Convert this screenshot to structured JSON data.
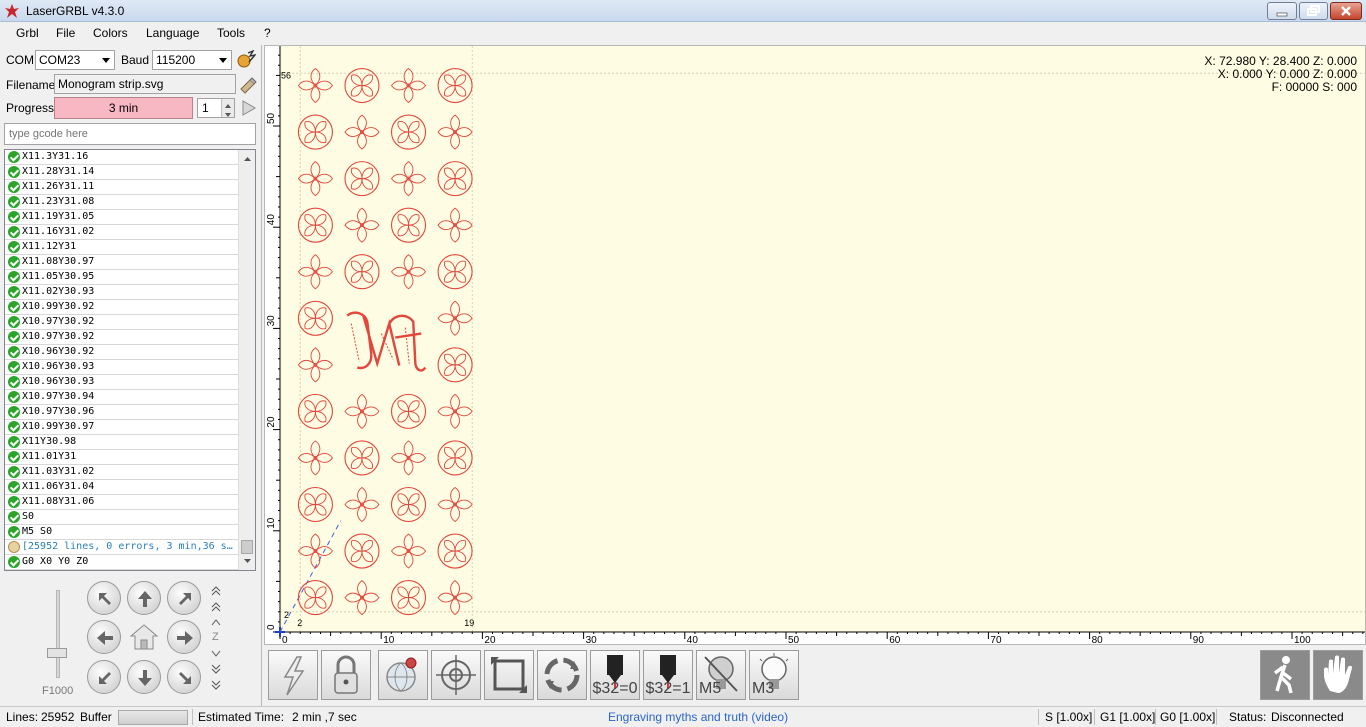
{
  "window": {
    "title": "LaserGRBL v4.3.0"
  },
  "menu": [
    "Grbl",
    "File",
    "Colors",
    "Language",
    "Tools",
    "?"
  ],
  "connection": {
    "com_label": "COM",
    "com_value": "COM23",
    "baud_label": "Baud",
    "baud_value": "115200"
  },
  "file": {
    "filename_label": "Filename",
    "filename_value": "Monogram strip.svg"
  },
  "progress": {
    "label": "Progress",
    "text": "3 min",
    "passes": "1"
  },
  "gcode_input": {
    "placeholder": "type gcode here"
  },
  "log_lines": [
    {
      "text": "X11.3Y31.16",
      "kind": "ok"
    },
    {
      "text": "X11.28Y31.14",
      "kind": "ok"
    },
    {
      "text": "X11.26Y31.11",
      "kind": "ok"
    },
    {
      "text": "X11.23Y31.08",
      "kind": "ok"
    },
    {
      "text": "X11.19Y31.05",
      "kind": "ok"
    },
    {
      "text": "X11.16Y31.02",
      "kind": "ok"
    },
    {
      "text": "X11.12Y31",
      "kind": "ok"
    },
    {
      "text": "X11.08Y30.97",
      "kind": "ok"
    },
    {
      "text": "X11.05Y30.95",
      "kind": "ok"
    },
    {
      "text": "X11.02Y30.93",
      "kind": "ok"
    },
    {
      "text": "X10.99Y30.92",
      "kind": "ok"
    },
    {
      "text": "X10.97Y30.92",
      "kind": "ok"
    },
    {
      "text": "X10.97Y30.92",
      "kind": "ok"
    },
    {
      "text": "X10.96Y30.92",
      "kind": "ok"
    },
    {
      "text": "X10.96Y30.93",
      "kind": "ok"
    },
    {
      "text": "X10.96Y30.93",
      "kind": "ok"
    },
    {
      "text": "X10.97Y30.94",
      "kind": "ok"
    },
    {
      "text": "X10.97Y30.96",
      "kind": "ok"
    },
    {
      "text": "X10.99Y30.97",
      "kind": "ok"
    },
    {
      "text": "X11Y30.98",
      "kind": "ok"
    },
    {
      "text": "X11.01Y31",
      "kind": "ok"
    },
    {
      "text": "X11.03Y31.02",
      "kind": "ok"
    },
    {
      "text": "X11.06Y31.04",
      "kind": "ok"
    },
    {
      "text": "X11.08Y31.06",
      "kind": "ok"
    },
    {
      "text": "S0",
      "kind": "ok"
    },
    {
      "text": "M5 S0",
      "kind": "ok"
    },
    {
      "text": "[25952 lines, 0 errors, 3 min,36 s…",
      "kind": "info"
    },
    {
      "text": "G0 X0 Y0 Z0",
      "kind": "ok"
    }
  ],
  "jog": {
    "feed": "F1000",
    "z_label": "Z"
  },
  "canvas": {
    "coords_line1": "X: 72.980 Y: 28.400 Z: 0.000",
    "coords_line2": "X: 0.000 Y: 0.000 Z: 0.000",
    "coords_line3": "F: 00000 S: 000",
    "x_ticks": [
      0,
      10,
      20,
      30,
      40,
      50,
      60,
      70,
      80,
      90,
      100
    ],
    "y_ticks": [
      0,
      10,
      20,
      30,
      40,
      50
    ],
    "bounds_labels": {
      "x_min": "2",
      "x_max": "19",
      "y_min": "2",
      "y_max": "56"
    },
    "drawing_color": "#e2463c",
    "background": "#fefde3"
  },
  "toolbar": {
    "buttons": [
      "$32=0",
      "$32=1",
      "M5",
      "M3"
    ]
  },
  "status": {
    "lines_label": "Lines:",
    "lines_value": "25952",
    "buffer_label": "Buffer",
    "est_label": "Estimated Time:",
    "est_value": "2 min ,7 sec",
    "link": "Engraving myths and truth (video)",
    "s_ovr": "S [1.00x]",
    "g1_ovr": "G1 [1.00x]",
    "g0_ovr": "G0 [1.00x]",
    "status_label": "Status:",
    "status_value": "Disconnected"
  }
}
